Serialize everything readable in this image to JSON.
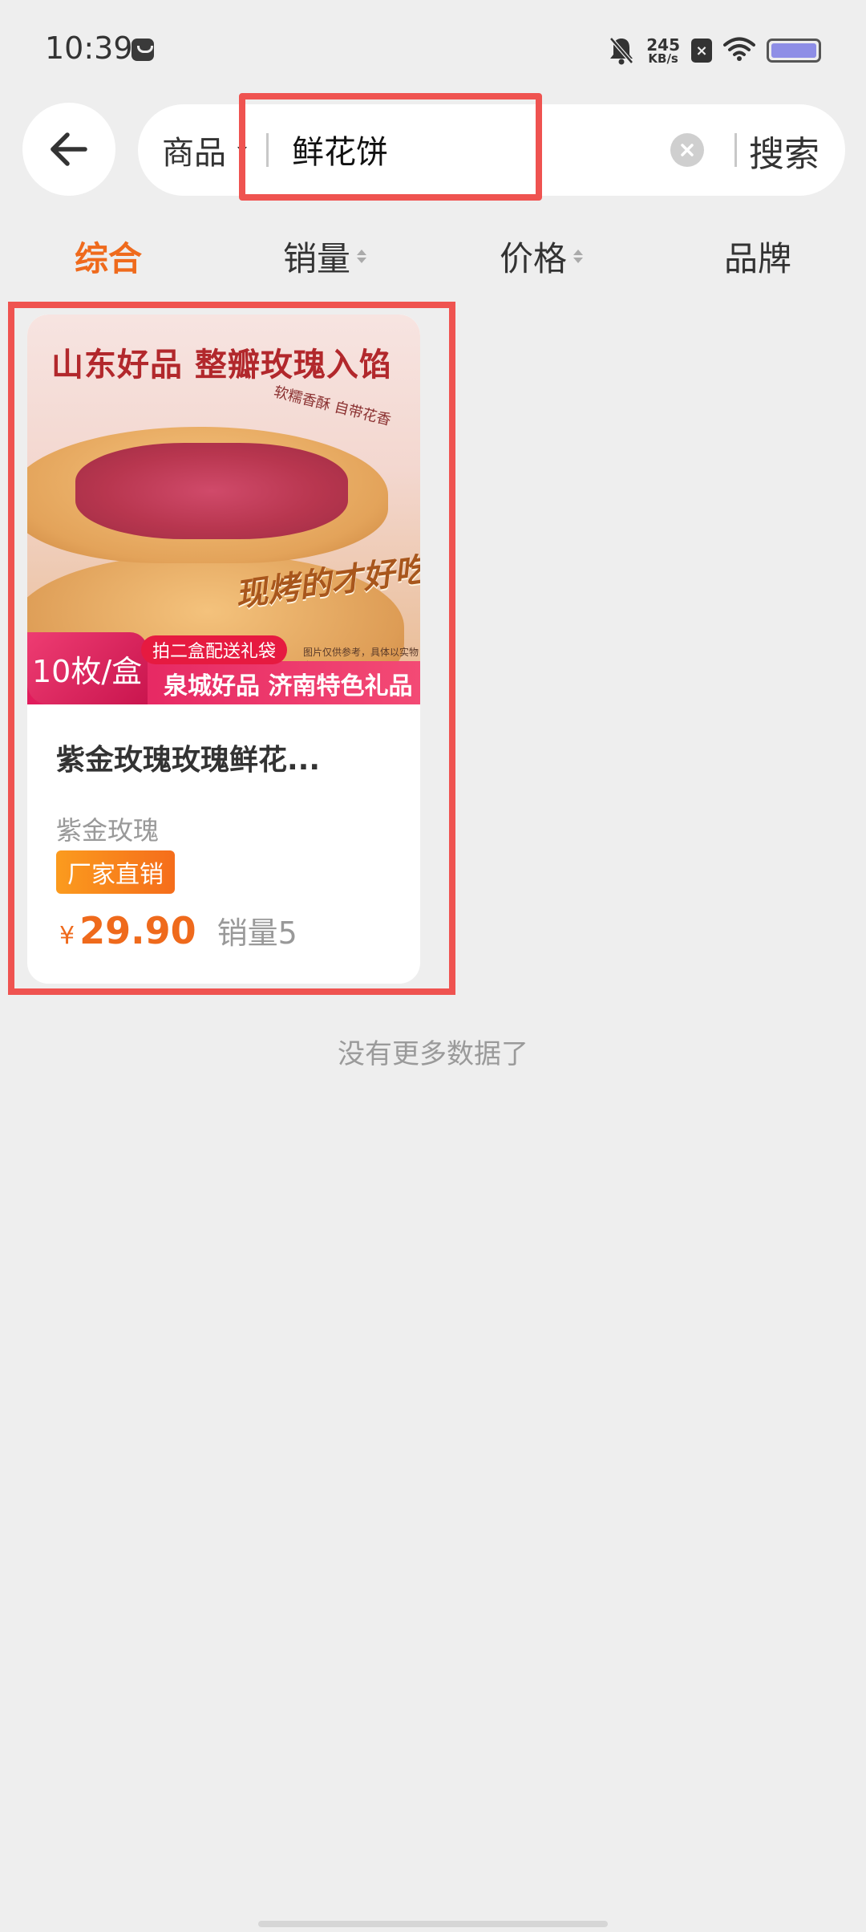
{
  "status_bar": {
    "time": "10:39",
    "net_speed_value": "245",
    "net_speed_unit": "KB/s",
    "icons": [
      "app-notification-icon",
      "bell-muted-icon",
      "sim-x-icon",
      "wifi-icon",
      "battery-icon"
    ]
  },
  "header": {
    "back_icon": "arrow-left-icon",
    "scope_label": "商品",
    "query": "鲜花饼",
    "clear_icon": "close-circle-icon",
    "search_label": "搜索"
  },
  "sort_tabs": [
    {
      "label": "综合",
      "active": true
    },
    {
      "label": "销量",
      "sortable": true
    },
    {
      "label": "价格",
      "sortable": true
    },
    {
      "label": "品牌"
    }
  ],
  "products": [
    {
      "image": {
        "title": "山东好品 整瓣玫瑰入馅",
        "subtitle": "软糯香酥 自带花香",
        "slogan": "现烤的才好吃!",
        "note": "图片仅供参考，具体以实物为准",
        "count_tag": "10枚/盒",
        "gift_tag": "拍二盒配送礼袋",
        "band_text": "泉城好品 济南特色礼品"
      },
      "name": "紫金玫瑰玫瑰鲜花...",
      "brand": "紫金玫瑰",
      "tag": "厂家直销",
      "price_symbol": "¥",
      "price": "29.90",
      "sales": "销量5"
    }
  ],
  "footer_text": "没有更多数据了",
  "colors": {
    "accent": "#ef6a1c",
    "highlight": "#ef5350",
    "background": "#eeeeee"
  }
}
